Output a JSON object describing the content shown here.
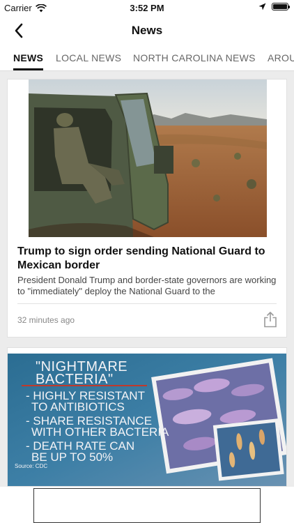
{
  "status_bar": {
    "carrier": "Carrier",
    "time": "3:52 PM"
  },
  "nav": {
    "title": "News"
  },
  "tabs": [
    {
      "label": "NEWS",
      "active": true
    },
    {
      "label": "LOCAL NEWS",
      "active": false
    },
    {
      "label": "NORTH CAROLINA NEWS",
      "active": false
    },
    {
      "label": "AROU",
      "active": false
    }
  ],
  "articles": [
    {
      "headline": "Trump to sign order sending National Guard to Mexican border",
      "summary": "President Donald Trump and border-state governors are working to \"immediately\" deploy the National Guard to the",
      "time_ago": "32 minutes ago"
    }
  ],
  "article2_image": {
    "title_line1": "\"NIGHTMARE",
    "title_line2": "BACTERIA\"",
    "item1_line1": "- HIGHLY RESISTANT",
    "item1_line2": "TO ANTIBIOTICS",
    "item2_line1": "- SHARE RESISTANCE",
    "item2_line2": "WITH OTHER BACTERIA",
    "item3_line1": "- DEATH RATE CAN",
    "item3_line2": "BE UP TO 50%",
    "source": "Source: CDC"
  },
  "icons": [
    "wifi-icon",
    "location-arrow-icon",
    "battery-icon",
    "back-chevron-icon",
    "share-icon"
  ],
  "colors": {
    "active_tab_underline": "#111111",
    "page_background": "#ececec"
  }
}
